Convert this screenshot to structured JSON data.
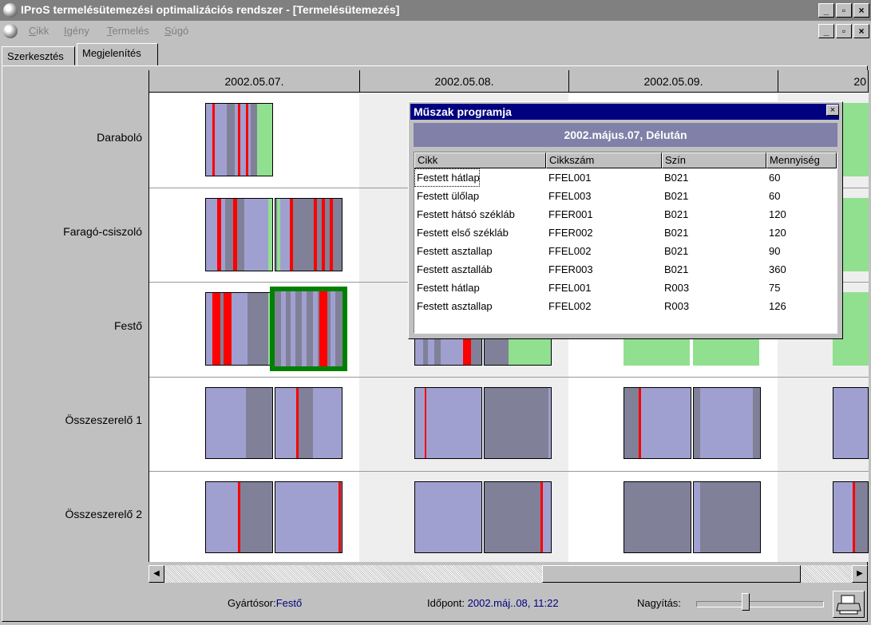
{
  "window": {
    "title": "IProS termelésütemezési optimalizációs rendszer - [Termelésütemezés]"
  },
  "menu": [
    "Cikk",
    "Igény",
    "Termelés",
    "Súgó"
  ],
  "tabs": [
    {
      "label": "Szerkesztés",
      "active": false
    },
    {
      "label": "Megjelenítés",
      "active": true
    }
  ],
  "days": [
    "2002.05.07.",
    "2002.05.08.",
    "2002.05.09.",
    "20"
  ],
  "rows": [
    "Daraboló",
    "Faragó-csiszoló",
    "Festő",
    "Összeszerelő 1",
    "Összeszerelő 2"
  ],
  "colors": {
    "light": "#a0a0d0",
    "dark": "#808098",
    "red": "#ff0000",
    "green": "#90e090",
    "highlight": "#008000"
  },
  "dialog": {
    "title": "Műszak programja",
    "subtitle": "2002.május.07, Délután",
    "columns": [
      "Cikk",
      "Cikkszám",
      "Szín",
      "Mennyiség"
    ],
    "rows": [
      [
        "Festett hátlap",
        "FFEL001",
        "B021",
        "60"
      ],
      [
        "Festett ülőlap",
        "FFEL003",
        "B021",
        "60"
      ],
      [
        "Festett hátsó székláb",
        "FFER001",
        "B021",
        "120"
      ],
      [
        "Festett első székláb",
        "FFER002",
        "B021",
        "120"
      ],
      [
        "Festett asztallap",
        "FFEL002",
        "B021",
        "90"
      ],
      [
        "Festett asztalláb",
        "FFER003",
        "B021",
        "360"
      ],
      [
        "Festett hátlap",
        "FFEL001",
        "R003",
        "75"
      ],
      [
        "Festett asztallap",
        "FFEL002",
        "R003",
        "126"
      ]
    ]
  },
  "status": {
    "line_label": "Gyártósor:",
    "line_value": "Festő",
    "time_label": "Időpont:",
    "time_value": "2002.máj..08, 11:22",
    "zoom_label": "Nagyítás:"
  }
}
